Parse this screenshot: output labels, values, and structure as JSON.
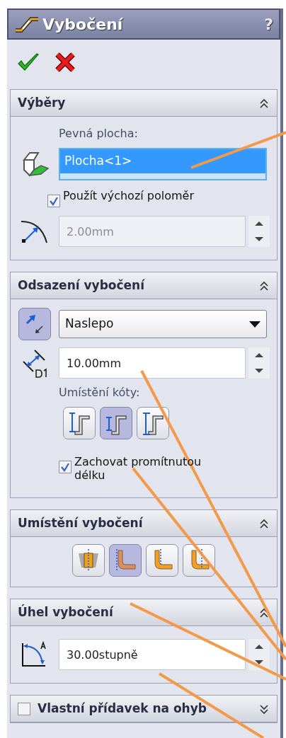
{
  "title": "Vybočení",
  "help": "?",
  "groups": [
    {
      "title": "Výběry",
      "expanded": true,
      "items": [
        {
          "kind": "label",
          "text": "Pevná plocha:"
        },
        {
          "kind": "selection",
          "value": "Plocha<1>"
        },
        {
          "kind": "checkbox",
          "label": "Použít výchozí poloměr",
          "checked": true
        },
        {
          "kind": "spin",
          "value": "2.00mm",
          "disabled": true
        }
      ]
    },
    {
      "title": "Odsazení vybočení",
      "expanded": true,
      "items": [
        {
          "kind": "dropdown",
          "active": true,
          "value": "Naslepo"
        },
        {
          "kind": "spin",
          "value": "10.00mm",
          "disabled": false
        },
        {
          "kind": "label",
          "text": "Umístění kóty:"
        },
        {
          "kind": "buttons",
          "buttons": [
            {
              "selected": false
            },
            {
              "selected": true
            },
            {
              "selected": false
            }
          ]
        },
        {
          "kind": "checkbox",
          "label": "Zachovat promítnutou délku",
          "checked": true
        }
      ]
    },
    {
      "title": "Umístění vybočení",
      "expanded": true,
      "items": [
        {
          "kind": "buttons",
          "buttons": [
            {
              "selected": false
            },
            {
              "selected": true
            },
            {
              "selected": false
            },
            {
              "selected": false
            }
          ]
        }
      ]
    },
    {
      "title": "Úhel vybočení",
      "expanded": true,
      "items": [
        {
          "kind": "spin",
          "value": "30.00stupně",
          "disabled": false
        }
      ]
    },
    {
      "title": "Vlastní přídavek na ohyb",
      "expanded": false,
      "checked": false
    }
  ]
}
